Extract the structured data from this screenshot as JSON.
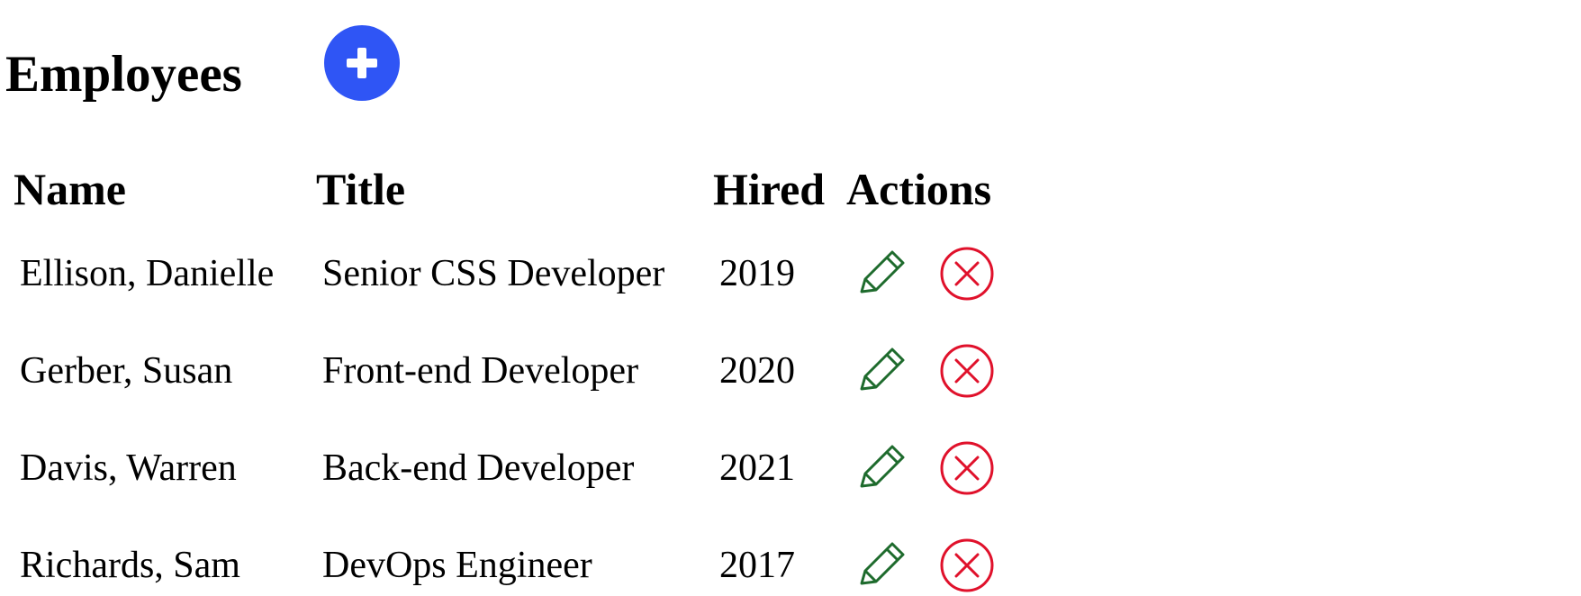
{
  "page": {
    "title": "Employees"
  },
  "icons": {
    "add": "plus-circle-icon",
    "edit": "pencil-icon",
    "delete": "x-circle-icon"
  },
  "colors": {
    "add_button": "#2f55f5",
    "edit_icon": "#1e6b2d",
    "delete_icon": "#e0112b"
  },
  "table": {
    "columns": [
      "Name",
      "Title",
      "Hired",
      "Actions"
    ],
    "rows": [
      {
        "name": "Ellison, Danielle",
        "title": "Senior CSS Developer",
        "hired": "2019"
      },
      {
        "name": "Gerber, Susan",
        "title": "Front-end Developer",
        "hired": "2020"
      },
      {
        "name": "Davis, Warren",
        "title": "Back-end Developer",
        "hired": "2021"
      },
      {
        "name": "Richards, Sam",
        "title": "DevOps Engineer",
        "hired": "2017"
      }
    ]
  }
}
